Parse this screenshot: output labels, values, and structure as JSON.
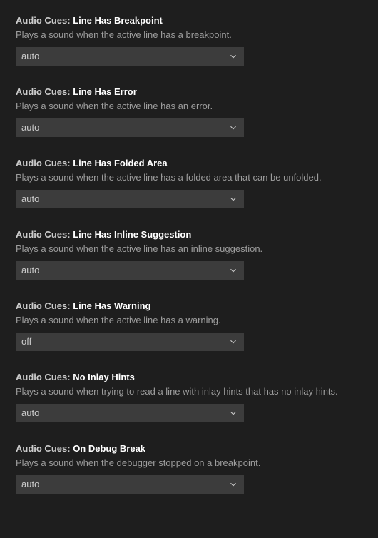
{
  "settings": [
    {
      "category": "Audio Cues:",
      "name": "Line Has Breakpoint",
      "description": "Plays a sound when the active line has a breakpoint.",
      "value": "auto"
    },
    {
      "category": "Audio Cues:",
      "name": "Line Has Error",
      "description": "Plays a sound when the active line has an error.",
      "value": "auto"
    },
    {
      "category": "Audio Cues:",
      "name": "Line Has Folded Area",
      "description": "Plays a sound when the active line has a folded area that can be unfolded.",
      "value": "auto"
    },
    {
      "category": "Audio Cues:",
      "name": "Line Has Inline Suggestion",
      "description": "Plays a sound when the active line has an inline suggestion.",
      "value": "auto"
    },
    {
      "category": "Audio Cues:",
      "name": "Line Has Warning",
      "description": "Plays a sound when the active line has a warning.",
      "value": "off"
    },
    {
      "category": "Audio Cues:",
      "name": "No Inlay Hints",
      "description": "Plays a sound when trying to read a line with inlay hints that has no inlay hints.",
      "value": "auto"
    },
    {
      "category": "Audio Cues:",
      "name": "On Debug Break",
      "description": "Plays a sound when the debugger stopped on a breakpoint.",
      "value": "auto"
    }
  ]
}
